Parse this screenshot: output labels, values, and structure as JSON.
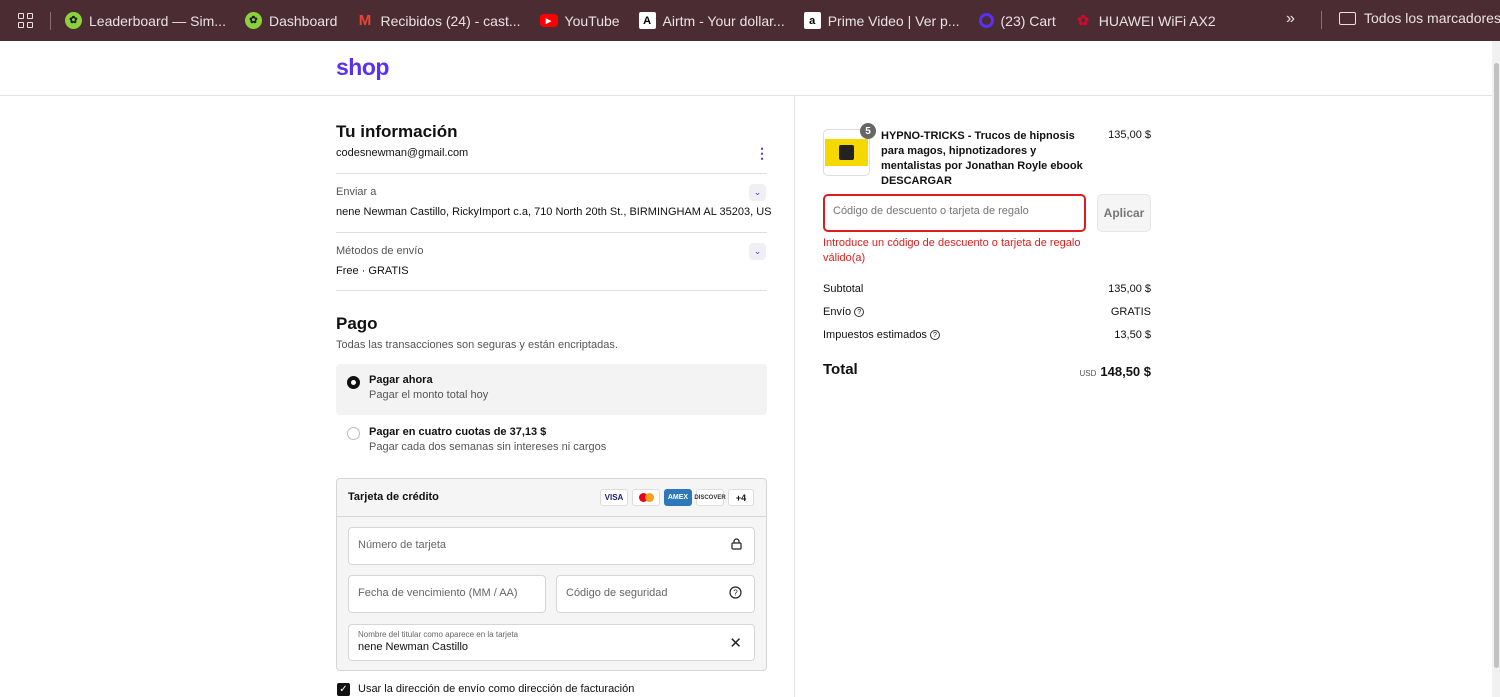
{
  "bookmarks": {
    "items": [
      {
        "label": "Leaderboard — Sim...",
        "icon": "chatgpt-green-icon",
        "color": "#8bd23a"
      },
      {
        "label": "Dashboard",
        "icon": "chatgpt-green-icon",
        "color": "#8bd23a"
      },
      {
        "label": "Recibidos (24) - cast...",
        "icon": "gmail-icon",
        "color": "#ea4335"
      },
      {
        "label": "YouTube",
        "icon": "youtube-icon",
        "color": "#ff0000"
      },
      {
        "label": "Airtm - Your dollar...",
        "icon": "airtm-icon",
        "color": "#ffffff"
      },
      {
        "label": "Prime Video | Ver p...",
        "icon": "amazon-icon",
        "color": "#ffffff"
      },
      {
        "label": "(23) Cart",
        "icon": "cart-icon",
        "color": "#5a31f4"
      },
      {
        "label": "HUAWEI WiFi AX2",
        "icon": "huawei-icon",
        "color": "#cf0a2c"
      }
    ],
    "more": "»",
    "folder_label": "Todos los marcadores"
  },
  "header": {
    "logo": "shop",
    "brand_color": "#5a31f4"
  },
  "info": {
    "title": "Tu información",
    "email": "codesnewman@gmail.com",
    "ship_to_label": "Enviar a",
    "ship_to_value": "nene Newman Castillo, RickyImport c.a, 710 North 20th St., BIRMINGHAM AL 35203, US",
    "methods_label": "Métodos de envío",
    "methods_value": "Free · GRATIS"
  },
  "payment": {
    "title": "Pago",
    "subtitle": "Todas las transacciones son seguras y están encriptadas.",
    "options": [
      {
        "label": "Pagar ahora",
        "sub": "Pagar el monto total hoy",
        "selected": true
      },
      {
        "label": "Pagar en cuatro cuotas de 37,13 $",
        "sub": "Pagar cada dos semanas sin intereses ni cargos",
        "selected": false
      }
    ],
    "card_title": "Tarjeta de crédito",
    "brands": [
      "VISA",
      "mastercard",
      "AMEX",
      "DISCOVER",
      "+4"
    ],
    "card_number_placeholder": "Número de tarjeta",
    "expiry_placeholder": "Fecha de vencimiento (MM / AA)",
    "cvv_placeholder": "Código de seguridad",
    "holder_label": "Nombre del titular como aparece en la tarjeta",
    "holder_value": "nene Newman Castillo",
    "billing_checkbox_label": "Usar la dirección de envío como dirección de facturación"
  },
  "summary": {
    "product": {
      "name": "HYPNO-TRICKS - Trucos de hipnosis para magos, hipnotizadores y mentalistas por Jonathan Royle ebook DESCARGAR",
      "price": "135,00 $",
      "quantity": "5"
    },
    "discount_placeholder": "Código de descuento o tarjeta de regalo",
    "apply_label": "Aplicar",
    "error": "Introduce un código de descuento o tarjeta de regalo válido(a)",
    "subtotal_label": "Subtotal",
    "subtotal_value": "135,00 $",
    "shipping_label": "Envío",
    "shipping_value": "GRATIS",
    "taxes_label": "Impuestos estimados",
    "taxes_value": "13,50 $",
    "total_label": "Total",
    "currency": "USD",
    "total_value": "148,50 $",
    "error_color": "#dd1d1d"
  }
}
